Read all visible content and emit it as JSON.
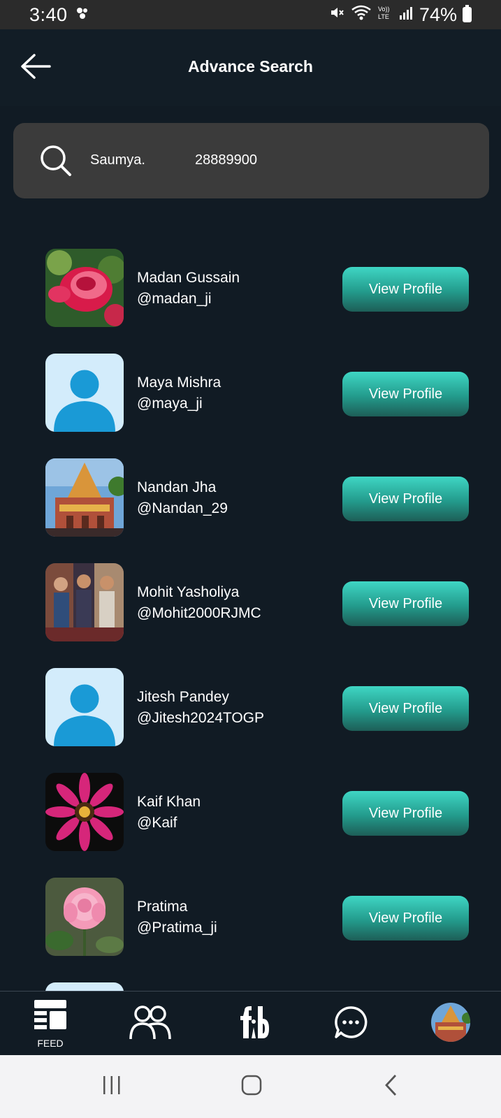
{
  "status_bar": {
    "time": "3:40",
    "battery": "74%",
    "icons": [
      "notification-icon",
      "mute-icon",
      "wifi-icon",
      "volte-icon",
      "signal-icon",
      "battery-icon"
    ]
  },
  "header": {
    "title": "Advance Search",
    "back_icon": "arrow-left-icon"
  },
  "search": {
    "name_query": "Saumya.",
    "number_query": "28889900",
    "icon": "search-icon"
  },
  "users": [
    {
      "name": "Madan Gussain",
      "handle": "@madan_ji",
      "avatar": "red-rose-photo",
      "button": "View Profile"
    },
    {
      "name": "Maya Mishra",
      "handle": "@maya_ji",
      "avatar": "default-user",
      "button": "View Profile"
    },
    {
      "name": "Nandan Jha",
      "handle": "@Nandan_29",
      "avatar": "temple-photo",
      "button": "View Profile"
    },
    {
      "name": "Mohit Yasholiya",
      "handle": "@Mohit2000RJMC",
      "avatar": "people-photo",
      "button": "View Profile"
    },
    {
      "name": "Jitesh Pandey",
      "handle": "@Jitesh2024TOGP",
      "avatar": "default-user",
      "button": "View Profile"
    },
    {
      "name": "Kaif Khan",
      "handle": "@Kaif",
      "avatar": "pink-flower-photo",
      "button": "View Profile"
    },
    {
      "name": "Pratima",
      "handle": "@Pratima_ji",
      "avatar": "pink-rose-photo",
      "button": "View Profile"
    }
  ],
  "bottom_nav": {
    "feed_label": "FEED",
    "items": [
      "feed-icon",
      "friends-icon",
      "fb-logo-icon",
      "chat-icon",
      "profile-avatar"
    ]
  },
  "colors": {
    "background": "#111b24",
    "search_bg": "#3b3b3b",
    "button_top": "#3fd6c4",
    "button_bottom": "#1d5e57",
    "default_avatar_bg": "#d3ecfb",
    "default_avatar_fg": "#1a9ad6"
  }
}
